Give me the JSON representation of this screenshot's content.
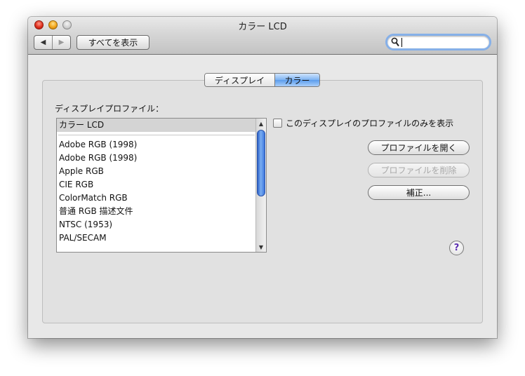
{
  "window": {
    "title": "カラー LCD"
  },
  "toolbar": {
    "back_glyph": "◀",
    "forward_glyph": "▶",
    "show_all_label": "すべてを表示",
    "search_placeholder": ""
  },
  "tabs": [
    {
      "label": "ディスプレイ",
      "selected": false
    },
    {
      "label": "カラー",
      "selected": true
    }
  ],
  "profile_list": {
    "label": "ディスプレイプロファイル：",
    "selected": "カラー LCD",
    "items": [
      "Adobe RGB (1998)",
      "Adobe RGB (1998)",
      "Apple RGB",
      "CIE RGB",
      "ColorMatch RGB",
      "普通 RGB 描述文件",
      "NTSC (1953)",
      "PAL/SECAM"
    ]
  },
  "options": {
    "only_this_display_label": "このディスプレイのプロファイルのみを表示",
    "only_this_display_checked": false
  },
  "buttons": {
    "open_profile": "プロファイルを開く",
    "delete_profile": "プロファイルを削除",
    "calibrate": "補正..."
  },
  "help": {
    "glyph": "?"
  },
  "scroll": {
    "up_glyph": "▲",
    "down_glyph": "▼"
  },
  "colors": {
    "selected_tab": "#6aa6ef",
    "scroll_thumb": "#3c77de",
    "search_focus_ring": "#86b0e8",
    "help_glyph": "#5b2fb0"
  }
}
